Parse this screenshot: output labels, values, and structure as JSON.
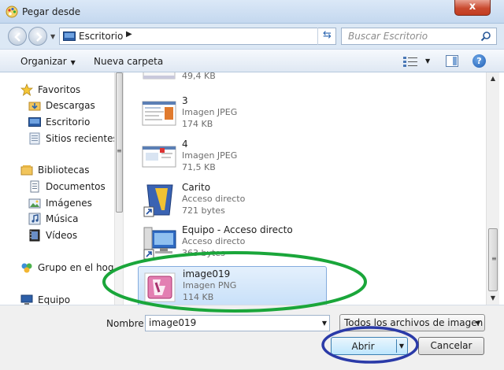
{
  "window": {
    "title": "Pegar desde",
    "close_label": "x"
  },
  "address": {
    "location": "Escritorio",
    "search_placeholder": "Buscar Escritorio"
  },
  "toolbar": {
    "organize_label": "Organizar",
    "new_folder_label": "Nueva carpeta"
  },
  "nav_pane": {
    "favorites": "Favoritos",
    "favorites_items": [
      "Descargas",
      "Escritorio",
      "Sitios recientes"
    ],
    "libraries": "Bibliotecas",
    "libraries_items": [
      "Documentos",
      "Imágenes",
      "Música",
      "Vídeos"
    ],
    "homegroup": "Grupo en el hogar",
    "computer": "Equipo"
  },
  "files": [
    {
      "name": "",
      "type": "",
      "size": "49,4 KB"
    },
    {
      "name": "3",
      "type": "Imagen JPEG",
      "size": "174 KB"
    },
    {
      "name": "4",
      "type": "Imagen JPEG",
      "size": "71,5 KB"
    },
    {
      "name": "Carito",
      "type": "Acceso directo",
      "size": "721 bytes"
    },
    {
      "name": "Equipo - Acceso directo",
      "type": "Acceso directo",
      "size": "363 bytes"
    },
    {
      "name": "image019",
      "type": "Imagen PNG",
      "size": "114 KB",
      "selected": true
    }
  ],
  "footer": {
    "filename_label": "Nombre:",
    "filename_value": "image019",
    "filter_value": "Todos los archivos de imagen",
    "open_label": "Abrir",
    "cancel_label": "Cancelar"
  },
  "colors": {
    "annotation_green": "#1aa63a",
    "annotation_blue": "#2a3aa8",
    "selection": "#c8e0f9"
  }
}
